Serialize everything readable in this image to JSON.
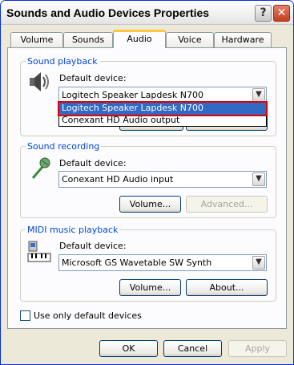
{
  "window": {
    "title": "Sounds and Audio Devices Properties",
    "help_glyph": "?",
    "close_glyph": "✕"
  },
  "tabs": [
    {
      "label": "Volume"
    },
    {
      "label": "Sounds"
    },
    {
      "label": "Audio"
    },
    {
      "label": "Voice"
    },
    {
      "label": "Hardware"
    }
  ],
  "active_tab": "Audio",
  "playback": {
    "group_label": "Sound playback",
    "device_label": "Default device:",
    "selected": "Logitech Speaker Lapdesk N700",
    "dropdown_options": [
      "Logitech Speaker Lapdesk N700",
      "Conexant HD Audio output"
    ]
  },
  "recording": {
    "group_label": "Sound recording",
    "device_label": "Default device:",
    "selected": "Conexant HD Audio input",
    "volume_button": "Volume...",
    "advanced_button": "Advanced..."
  },
  "midi": {
    "group_label": "MIDI music playback",
    "device_label": "Default device:",
    "selected": "Microsoft GS Wavetable SW Synth",
    "volume_button": "Volume...",
    "about_button": "About..."
  },
  "checkbox": {
    "label": "Use only default devices",
    "checked": false
  },
  "footer": {
    "ok": "OK",
    "cancel": "Cancel",
    "apply": "Apply"
  },
  "glyphs": {
    "combo_arrow": "▼"
  }
}
